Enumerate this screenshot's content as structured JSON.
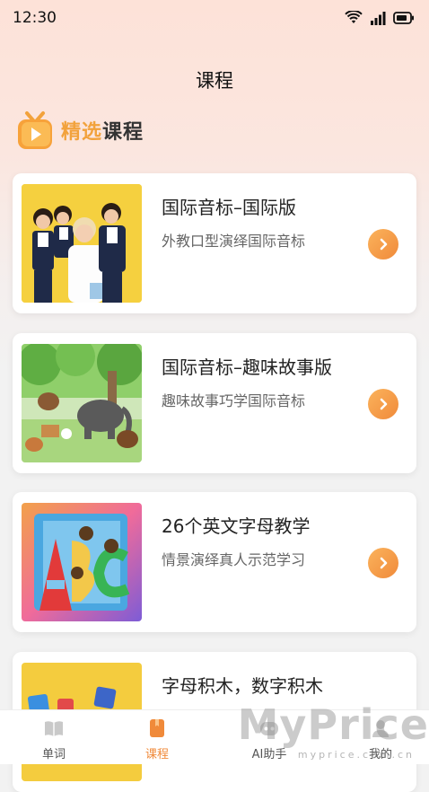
{
  "status_bar": {
    "time": "12:30"
  },
  "page": {
    "title": "课程"
  },
  "section": {
    "highlight": "精选",
    "rest": "课程"
  },
  "courses": [
    {
      "title": "国际音标–国际版",
      "subtitle": "外教口型演绎国际音标"
    },
    {
      "title": "国际音标–趣味故事版",
      "subtitle": "趣味故事巧学国际音标"
    },
    {
      "title": "26个英文字母教学",
      "subtitle": "情景演绎真人示范学习"
    },
    {
      "title": "字母积木，数字积木",
      "subtitle": ""
    }
  ],
  "tabs": [
    {
      "label": "单词",
      "icon": "book-icon"
    },
    {
      "label": "课程",
      "icon": "course-icon"
    },
    {
      "label": "AI助手",
      "icon": "robot-icon"
    },
    {
      "label": "我的",
      "icon": "profile-icon"
    }
  ],
  "watermark": {
    "logo": "MyPrice",
    "url": "myprice.com.cn"
  },
  "colors": {
    "accent": "#f08a3a",
    "section_highlight": "#f2a23c",
    "header_bg": "#fde2d8"
  }
}
